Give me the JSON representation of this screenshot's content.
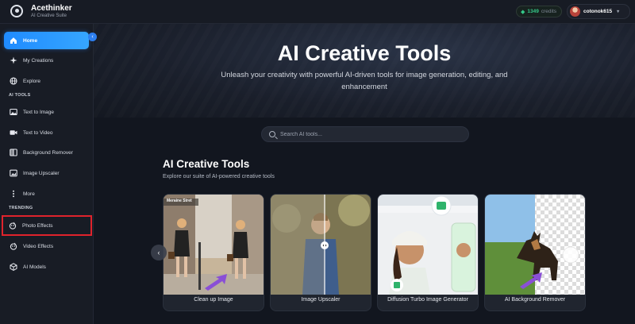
{
  "app": {
    "name": "Acethinker",
    "subtitle": "AI Creative Suite"
  },
  "header": {
    "credits_amount": "1349",
    "credits_label": "credits",
    "username": "cotonok615"
  },
  "sidebar": {
    "collapse_icon": "chevron-left-icon",
    "items": [
      {
        "label": "Home",
        "icon": "home-icon",
        "active": true
      },
      {
        "label": "My Creations",
        "icon": "sparkle-icon"
      },
      {
        "label": "Explore",
        "icon": "globe-icon"
      }
    ],
    "ai_tools_label": "AI TOOLS",
    "ai_tools": [
      {
        "label": "Text to Image",
        "icon": "image-icon"
      },
      {
        "label": "Text to Video",
        "icon": "video-icon"
      },
      {
        "label": "Background Remover",
        "icon": "split-icon"
      },
      {
        "label": "Image Upscaler",
        "icon": "upscale-icon"
      },
      {
        "label": "More",
        "icon": "more-icon"
      }
    ],
    "trending_label": "TRENDING",
    "trending": [
      {
        "label": "Photo Effects",
        "icon": "effects-icon",
        "highlighted": true
      },
      {
        "label": "Video Effects",
        "icon": "effects-icon"
      },
      {
        "label": "AI Models",
        "icon": "cube-icon"
      }
    ]
  },
  "hero": {
    "title": "AI Creative Tools",
    "subtitle": "Unleash your creativity with powerful AI-driven tools for image generation, editing, and enhancement"
  },
  "search": {
    "placeholder": "Search AI tools..."
  },
  "section": {
    "title": "AI Creative Tools",
    "subtitle": "Explore our suite of AI-powered creative tools"
  },
  "cards": [
    {
      "caption": "Clean up Image",
      "image_tag": "Meraine Stret"
    },
    {
      "caption": "Image Upscaler"
    },
    {
      "caption": "Diffusion Turbo Image Generator"
    },
    {
      "caption": "AI Background Remover"
    }
  ],
  "colors": {
    "accent": "#1f8bff",
    "highlight_box": "#e0232c",
    "credits_green": "#35c98a"
  }
}
